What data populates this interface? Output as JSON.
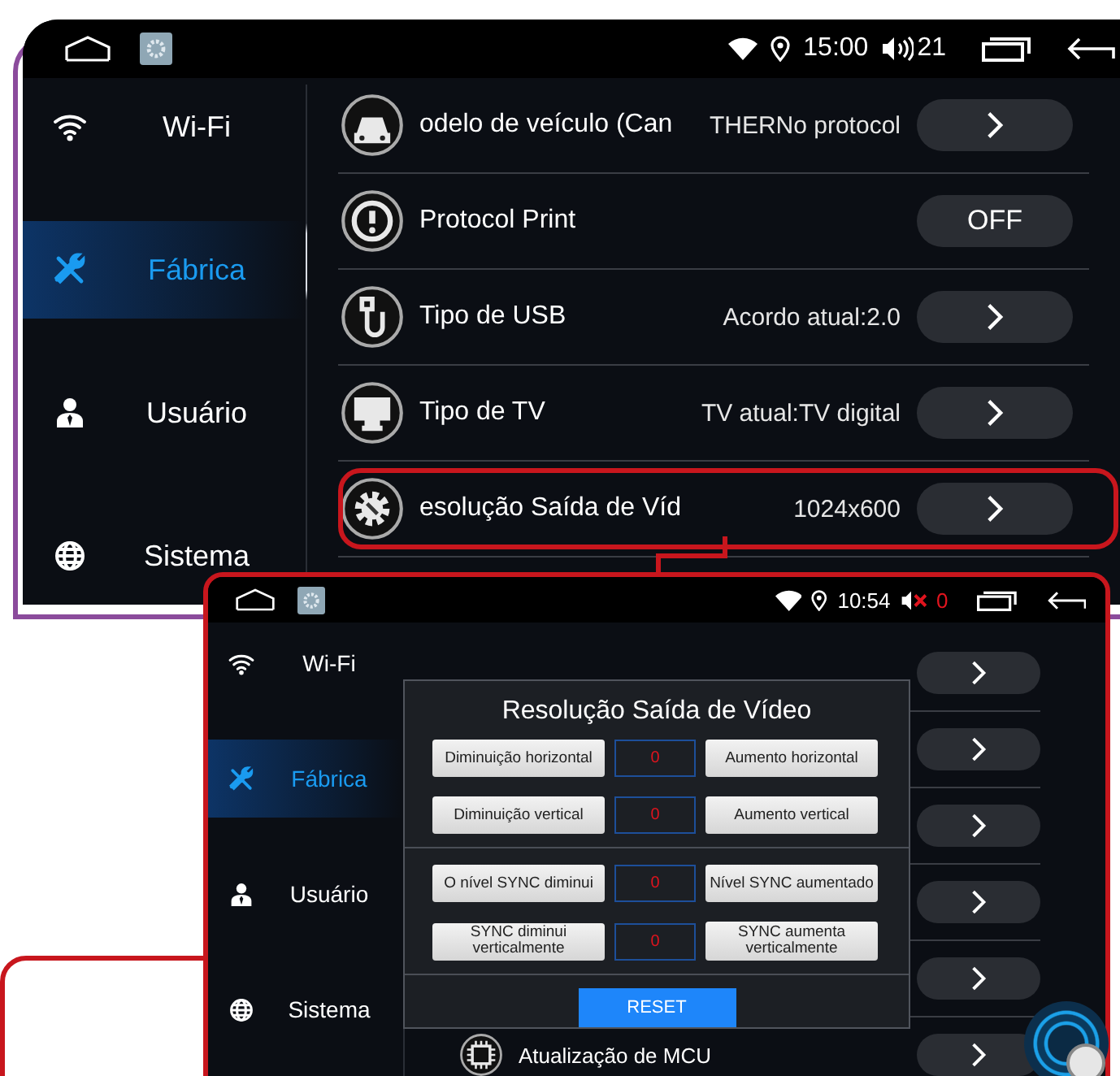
{
  "screens": [
    {
      "status_bar": {
        "time": "15:00",
        "volume": "21",
        "muted": false
      },
      "sidebar": [
        {
          "label": "Wi-Fi",
          "selected": false
        },
        {
          "label": "Fábrica",
          "selected": true
        },
        {
          "label": "Usuário",
          "selected": false
        },
        {
          "label": "Sistema",
          "selected": false
        }
      ],
      "rows": [
        {
          "title": "odelo de veículo (Can",
          "value": "THERNo protocol",
          "control": {
            "kind": "arrow"
          },
          "highlighted": false
        },
        {
          "title": "Protocol Print",
          "control": {
            "kind": "toggle",
            "label": "OFF"
          },
          "highlighted": false
        },
        {
          "title": "Tipo de USB",
          "value": "Acordo atual:2.0",
          "control": {
            "kind": "arrow"
          },
          "highlighted": false
        },
        {
          "title": "Tipo de TV",
          "value": "TV atual:TV digital",
          "control": {
            "kind": "arrow"
          },
          "highlighted": false
        },
        {
          "title": "esolução Saída de Víd",
          "value": "1024x600",
          "control": {
            "kind": "arrow"
          },
          "highlighted": true
        }
      ]
    },
    {
      "status_bar": {
        "time": "10:54",
        "volume": "0",
        "muted": true
      },
      "sidebar": [
        {
          "label": "Wi-Fi",
          "selected": false
        },
        {
          "label": "Fábrica",
          "selected": true
        },
        {
          "label": "Usuário",
          "selected": false
        },
        {
          "label": "Sistema",
          "selected": false
        }
      ],
      "rows": [
        {
          "control": {
            "kind": "arrow"
          }
        },
        {
          "control": {
            "kind": "arrow"
          }
        },
        {
          "control": {
            "kind": "arrow"
          }
        },
        {
          "control": {
            "kind": "arrow"
          }
        },
        {
          "control": {
            "kind": "arrow"
          }
        },
        {
          "title": "Atualização de MCU",
          "control": {
            "kind": "arrow"
          }
        }
      ],
      "dialog": {
        "title": "Resolução Saída de Vídeo",
        "groups": [
          [
            {
              "decrease": "Diminuição horizontal",
              "value": "0",
              "increase": "Aumento horizontal"
            },
            {
              "decrease": "Diminuição vertical",
              "value": "0",
              "increase": "Aumento vertical"
            }
          ],
          [
            {
              "decrease": "O nível SYNC diminui",
              "value": "0",
              "increase": "Nível SYNC aumentado"
            },
            {
              "decrease": "SYNC diminui verticalmente",
              "value": "0",
              "increase": "SYNC aumenta verticalmente"
            }
          ]
        ],
        "reset": "RESET"
      }
    }
  ]
}
